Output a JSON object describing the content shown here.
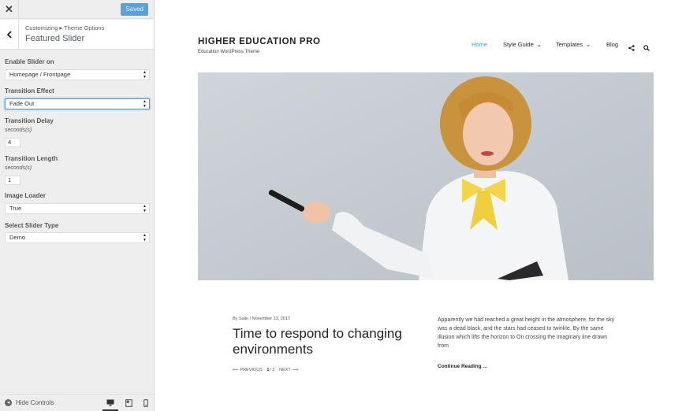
{
  "topbar": {
    "close_label": "✕",
    "saved_label": "Saved"
  },
  "section": {
    "breadcrumb": "Customizing ▸ Theme Options",
    "title": "Featured Slider"
  },
  "controls": {
    "enable_slider": {
      "label": "Enable Slider on",
      "value": "Homepage / Frontpage"
    },
    "transition_effect": {
      "label": "Transition Effect",
      "value": "Fade Out"
    },
    "transition_delay": {
      "label": "Transition Delay",
      "unit": "seconds(s)",
      "value": "4"
    },
    "transition_length": {
      "label": "Transition Length",
      "unit": "seconds(s)",
      "value": "1"
    },
    "image_loader": {
      "label": "Image Loader",
      "value": "True"
    },
    "slider_type": {
      "label": "Select Slider Type",
      "value": "Demo"
    }
  },
  "footer": {
    "hide_controls_label": "Hide Controls",
    "active_device": "desktop"
  },
  "site": {
    "title": "HIGHER EDUCATION PRO",
    "tagline": "Education WordPress Theme",
    "accent_color": "#3c9fd4",
    "nav": [
      {
        "label": "Home",
        "active": true
      },
      {
        "label": "Style Guide",
        "dropdown": true
      },
      {
        "label": "Templates",
        "dropdown": true
      },
      {
        "label": "Blog"
      }
    ],
    "nav_icons": [
      "share-icon",
      "search-icon"
    ]
  },
  "post": {
    "meta": "By Salin / November 13, 2017",
    "title": "Time to respond to changing environments",
    "nav_prev": "⟵ PREVIOUS",
    "nav_current": "1",
    "nav_total": "/ 2",
    "nav_next": "NEXT ⟶",
    "excerpt": "Apparently we had reached a great height in the atmosphere, for the sky was a dead black, and the stars had ceased to twinkle. By the same illusion which lifts the horizon to On crossing the imaginary line drawn from",
    "continue_label": "Continue Reading ..."
  }
}
